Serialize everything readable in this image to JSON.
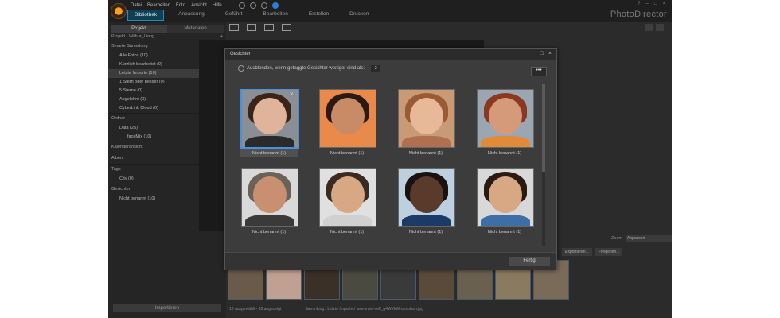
{
  "app": {
    "brand": "PhotoDirector",
    "menu": [
      "Datei",
      "Bearbeiten",
      "Foto",
      "Ansicht",
      "Hilfe"
    ],
    "tabs": [
      "Bibliothek",
      "Anpassung",
      "Geführt",
      "Bearbeiten",
      "Erstellen",
      "Drucken"
    ],
    "active_tab": "Bibliothek"
  },
  "left_panel": {
    "tabs": [
      "Projekt",
      "Metadaten"
    ],
    "project": "Projekt - Wilbur_Liang",
    "sections": [
      {
        "title": "Smarte Sammlung",
        "items": [
          "Alle Fotos (10)",
          "Kürzlich bearbeitet (0)",
          "Letzte Importe (10)",
          "1 Stern oder besser (0)",
          "5 Sterne (0)",
          "Abgelehnt (0)",
          "CyberLink Cloud (0)"
        ]
      },
      {
        "title": "Ordner",
        "items": [
          "Data (25)",
          "faceMix (10)"
        ]
      },
      {
        "title": "Kalenderansicht",
        "items": []
      },
      {
        "title": "Alben",
        "items": []
      },
      {
        "title": "Tags",
        "items": [
          "City (0)"
        ]
      },
      {
        "title": "Gesichter",
        "items": [
          "Nicht benannt (10)"
        ]
      }
    ],
    "import_button": "Importieren"
  },
  "viewer": {
    "zoom_label": "Zoom",
    "zoom_value": "Anpassen",
    "export_label": "Exportieren...",
    "share_label": "Freigeben..."
  },
  "status": {
    "selection": "10 ausgewählt - 10 angezeigt",
    "path": "Sammlung / Letzte Importe / face-mixe-self_g4WYkW-unsplash.jpg"
  },
  "dialog": {
    "title": "Gesichter",
    "hide_option_label": "Ausblenden, wenn getaggte Gesichter weniger sind als:",
    "hide_option_value": "2",
    "more_label": "•••",
    "done_label": "Fertig",
    "faces": [
      {
        "label": "Nicht benannt (1)",
        "selected": true,
        "bg": "#8a8f96",
        "skin": "#e0b49a",
        "hair": "#3a2418",
        "shirt": "#2a2a2a"
      },
      {
        "label": "Nicht benannt (1)",
        "selected": false,
        "bg": "#e98a4a",
        "skin": "#c98a66",
        "hair": "#2c1a12",
        "shirt": "#e98a4a"
      },
      {
        "label": "Nicht benannt (1)",
        "selected": false,
        "bg": "#c99a76",
        "skin": "#e7b998",
        "hair": "#9a5a34",
        "shirt": "#b07050"
      },
      {
        "label": "Nicht benannt (1)",
        "selected": false,
        "bg": "#9aa7b2",
        "skin": "#d59a7a",
        "hair": "#8a3820",
        "shirt": "#e08a3a"
      },
      {
        "label": "Nicht benannt (1)",
        "selected": false,
        "bg": "#d9d9d9",
        "skin": "#c89070",
        "hair": "#6a6258",
        "shirt": "#3a3a3a"
      },
      {
        "label": "Nicht benannt (1)",
        "selected": false,
        "bg": "#e0e0e0",
        "skin": "#d8a884",
        "hair": "#3a2a20",
        "shirt": "#d0d0d0"
      },
      {
        "label": "Nicht benannt (1)",
        "selected": false,
        "bg": "#bcd0e0",
        "skin": "#5a3a2a",
        "hair": "#1a1210",
        "shirt": "#1c3a66"
      },
      {
        "label": "Nicht benannt (1)",
        "selected": false,
        "bg": "#d8d8d8",
        "skin": "#d8a884",
        "hair": "#2a1a12",
        "shirt": "#3d6ea6"
      }
    ]
  }
}
